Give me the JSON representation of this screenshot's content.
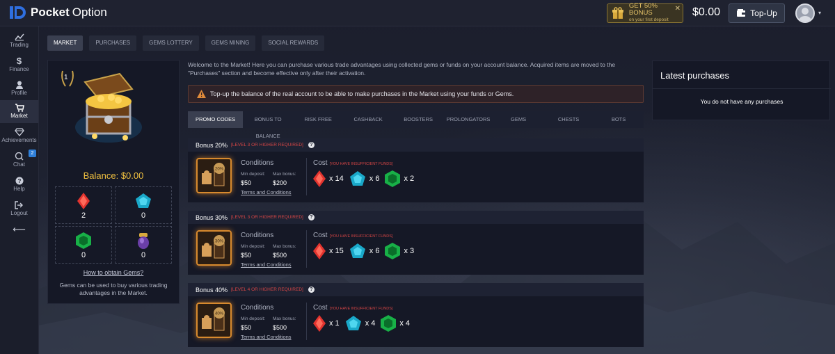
{
  "brand": {
    "name_bold": "Pocket",
    "name_light": "Option"
  },
  "topbar": {
    "bonus_main": "GET 50% BONUS",
    "bonus_sub": "on your first deposit",
    "bonus_close": "✕",
    "balance": "$0.00",
    "topup_label": "Top-Up",
    "avatar_caret": "▾"
  },
  "sidebar": {
    "items": [
      {
        "label": "Trading",
        "icon": "chart-icon"
      },
      {
        "label": "Finance",
        "icon": "dollar-icon"
      },
      {
        "label": "Profile",
        "icon": "user-icon"
      },
      {
        "label": "Market",
        "icon": "cart-icon"
      },
      {
        "label": "Achievements",
        "icon": "diamond-icon"
      },
      {
        "label": "Chat",
        "icon": "chat-icon",
        "badge": "2"
      },
      {
        "label": "Help",
        "icon": "help-icon"
      },
      {
        "label": "Logout",
        "icon": "logout-icon"
      }
    ],
    "collapse_arrow": "⟵"
  },
  "tabs": [
    "MARKET",
    "PURCHASES",
    "GEMS LOTTERY",
    "GEMS MINING",
    "SOCIAL REWARDS"
  ],
  "left_panel": {
    "level": "1",
    "balance_label": "Balance: $0.00",
    "gems": [
      {
        "name": "red-gem",
        "count": "2"
      },
      {
        "name": "blue-gem",
        "count": "0"
      },
      {
        "name": "green-gem",
        "count": "0"
      },
      {
        "name": "purple-gem",
        "count": "0"
      }
    ],
    "how_link": "How to obtain Gems?",
    "note": "Gems can be used to buy various trading advantages in the Market."
  },
  "main": {
    "welcome": "Welcome to the Market! Here you can purchase various trade advantages using collected gems or funds on your account balance. Acquired items are moved to the \"Purchases\" section and become effective only after their activation.",
    "warning": "Top-up the balance of the real account to be able to make purchases in the Market using your funds or Gems.",
    "subtabs": [
      "PROMO CODES",
      "BONUS TO BALANCE",
      "RISK FREE",
      "CASHBACK",
      "BOOSTERS",
      "PROLONGATORS",
      "GEMS",
      "CHESTS",
      "BOTS"
    ],
    "promos": [
      {
        "title": "Bonus 20%",
        "requirement": "[LEVEL 3 OR HIGHER REQUIRED]",
        "badge": "20%",
        "conditions": "Conditions",
        "min_label": "Min deposit:",
        "min_value": "$50",
        "max_label": "Max bonus:",
        "max_value": "$200",
        "terms": "Terms and Conditions",
        "cost": "Cost",
        "insufficient": "[YOU HAVE INSUFFICIENT FUNDS]",
        "red": "x 14",
        "blue": "x 6",
        "green": "x 2"
      },
      {
        "title": "Bonus 30%",
        "requirement": "[LEVEL 3 OR HIGHER REQUIRED]",
        "badge": "30%",
        "conditions": "Conditions",
        "min_label": "Min deposit:",
        "min_value": "$50",
        "max_label": "Max bonus:",
        "max_value": "$500",
        "terms": "Terms and Conditions",
        "cost": "Cost",
        "insufficient": "[YOU HAVE INSUFFICIENT FUNDS]",
        "red": "x 15",
        "blue": "x 6",
        "green": "x 3"
      },
      {
        "title": "Bonus 40%",
        "requirement": "[LEVEL 4 OR HIGHER REQUIRED]",
        "badge": "40%",
        "conditions": "Conditions",
        "min_label": "Min deposit:",
        "min_value": "$50",
        "max_label": "Max bonus:",
        "max_value": "$500",
        "terms": "Terms and Conditions",
        "cost": "Cost",
        "insufficient": "[YOU HAVE INSUFFICIENT FUNDS]",
        "red": "x 1",
        "blue": "x 4",
        "green": "x 4"
      }
    ]
  },
  "right_panel": {
    "title": "Latest purchases",
    "empty": "You do not have any purchases"
  },
  "colors": {
    "accent_gold": "#f0c040",
    "warning_red": "#d44545",
    "brand_blue": "#2f6fe0"
  }
}
